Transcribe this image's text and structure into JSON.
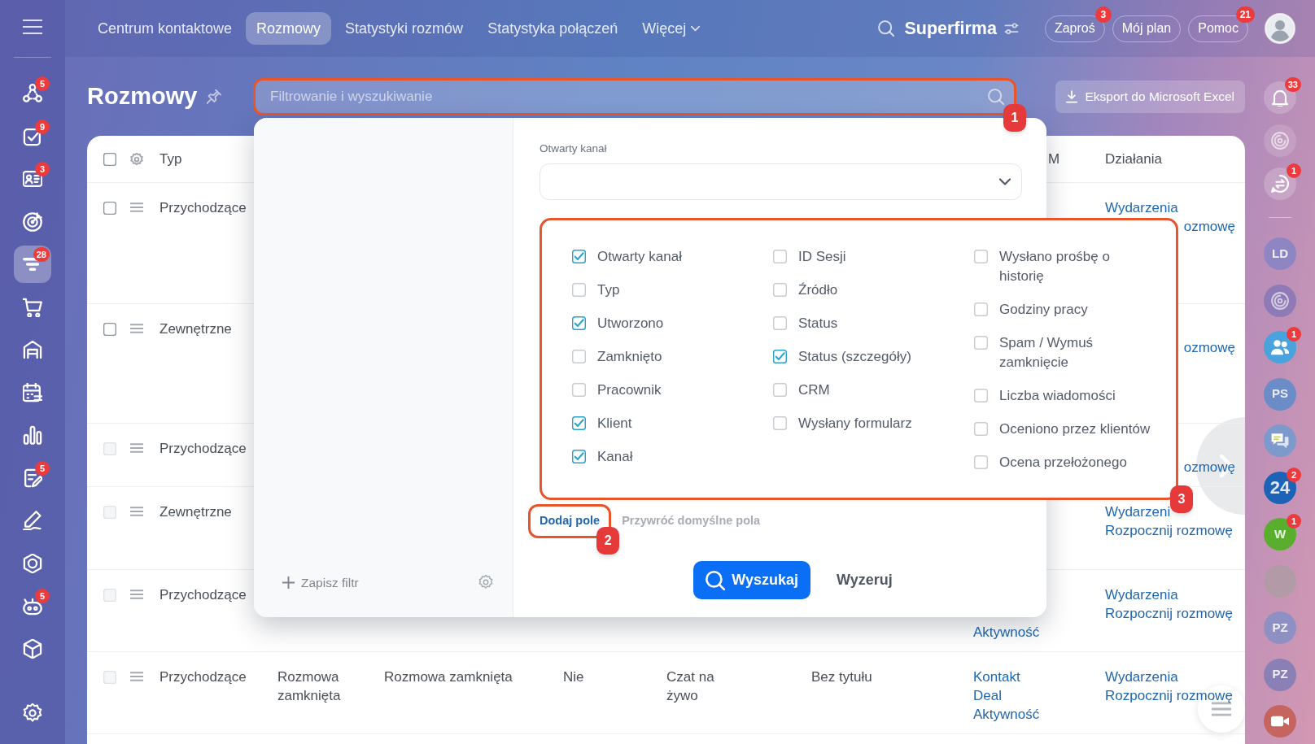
{
  "left_sidebar": {
    "items": [
      {
        "badge": "5",
        "selected": false
      },
      {
        "badge": "9",
        "selected": false
      },
      {
        "badge": "3",
        "selected": false
      },
      {
        "selected": false
      },
      {
        "badge": "28",
        "selected": true
      },
      {
        "selected": false
      },
      {
        "selected": false
      },
      {
        "selected": false
      },
      {
        "selected": false
      },
      {
        "badge": "5",
        "selected": false
      },
      {
        "selected": false
      },
      {
        "selected": false
      },
      {
        "badge": "5",
        "selected": false
      },
      {
        "selected": false
      }
    ]
  },
  "nav_tabs": [
    {
      "label": "Centrum kontaktowe",
      "selected": false,
      "kind": "link"
    },
    {
      "label": "Rozmowy",
      "selected": true,
      "kind": "link"
    },
    {
      "label": "Statystyki rozmów",
      "selected": false,
      "kind": "link"
    },
    {
      "label": "Statystyka połączeń",
      "selected": false,
      "kind": "link"
    },
    {
      "label": "Więcej",
      "selected": false,
      "kind": "menu"
    }
  ],
  "company": {
    "name": "Superfirma"
  },
  "header_buttons": [
    {
      "label": "Zaproś",
      "badge": "3"
    },
    {
      "label": "Mój plan"
    },
    {
      "label": "Pomoc",
      "badge": "21"
    }
  ],
  "page": {
    "title": "Rozmowy"
  },
  "search_field": {
    "placeholder": "Filtrowanie i wyszukiwanie",
    "highlighted": true,
    "annotation": "1"
  },
  "export_button": {
    "label": "Eksport do Microsoft Excel"
  },
  "right_sidebar": {
    "items": [
      {
        "kind": "button",
        "badge": "33"
      },
      {
        "kind": "button"
      },
      {
        "kind": "button",
        "badge": "1"
      },
      {
        "kind": "initials",
        "text": "LD",
        "color": "#8e86c2"
      },
      {
        "kind": "button"
      },
      {
        "kind": "button",
        "badge": "1"
      },
      {
        "kind": "initials",
        "text": "PS",
        "color": "#6b8cc6"
      },
      {
        "kind": "button"
      },
      {
        "kind": "initials",
        "text": "24",
        "color": "#1c63b7",
        "badge": "2"
      },
      {
        "kind": "initials",
        "text": "W",
        "color": "#5aae2e",
        "badge": "1"
      },
      {
        "kind": "photo"
      },
      {
        "kind": "initials",
        "text": "PZ",
        "color": "#8e90c3"
      },
      {
        "kind": "initials",
        "text": "PZ",
        "color": "#8a80b6"
      },
      {
        "kind": "button"
      }
    ]
  },
  "table": {
    "header": {
      "checkbox": {
        "checked": false
      },
      "column_1": "Typ",
      "column_7": "M",
      "column_8": "Działania"
    },
    "rows": [
      {
        "checkbox": {
          "checked": false,
          "disabled": false
        },
        "column_1": "Przychodzące",
        "column_8": {
          "events": {
            "text": "Wydarzenia",
            "cut_start": false
          },
          "start_chat": {
            "text": "ozmowę",
            "cut_start": true
          }
        }
      },
      {
        "checkbox": {
          "checked": false,
          "disabled": false
        },
        "column_1": "Zewnętrzne",
        "column_8": {
          "start_chat": {
            "text": "ozmowę",
            "cut_start": true
          }
        }
      },
      {
        "checkbox": {
          "checked": false,
          "disabled": true
        },
        "column_1": "Przychodzące",
        "column_8": {
          "start_chat": {
            "text": "ozmowę",
            "cut_start": true
          }
        }
      },
      {
        "checkbox": {
          "checked": false,
          "disabled": true
        },
        "column_1": "Zewnętrzne",
        "column_8": {
          "events": {
            "text": "Wydarzeni",
            "cut_start": false
          },
          "start_chat": {
            "text": "Rozpocznij rozmowę",
            "cut_start": false
          }
        }
      },
      {
        "checkbox": {
          "checked": false,
          "disabled": true
        },
        "column_1": "Przychodzące",
        "column_7": {
          "activity": "Aktywność"
        },
        "column_8": {
          "events": {
            "text": "Wydarzenia",
            "cut_start": false
          },
          "start_chat": {
            "text": "Rozpocznij rozmowę",
            "cut_start": false
          }
        }
      },
      {
        "checkbox": {
          "checked": false,
          "disabled": true
        },
        "column_1": "Przychodzące",
        "column_2": "Rozmowa zamknięta",
        "column_3": "Rozmowa zamknięta",
        "column_4": "Nie",
        "column_5": "Czat na żywo",
        "column_6": "Bez tytułu",
        "column_7": {
          "contact": "Kontakt",
          "deal": "Deal",
          "activity": "Aktywność"
        },
        "column_8": {
          "events": {
            "text": "Wydarzenia",
            "cut_start": false
          },
          "start_chat": {
            "text": "Rozpocznij rozmowę",
            "cut_start": false
          }
        }
      }
    ]
  },
  "filter_popup": {
    "save_filter_button": "Zapisz filtr",
    "open_channel_select": {
      "label": "Otwarty kanał"
    },
    "fields_panel": {
      "highlighted": true,
      "annotation": "3",
      "columns": [
        {
          "fields": [
            {
              "label": "Otwarty kanał",
              "checked": true
            },
            {
              "label": "Typ",
              "checked": false
            },
            {
              "label": "Utworzono",
              "checked": true
            },
            {
              "label": "Zamknięto",
              "checked": false
            },
            {
              "label": "Pracownik",
              "checked": false
            },
            {
              "label": "Klient",
              "checked": true
            },
            {
              "label": "Kanał",
              "checked": true
            }
          ]
        },
        {
          "fields": [
            {
              "label": "ID Sesji",
              "checked": false
            },
            {
              "label": "Źródło",
              "checked": false
            },
            {
              "label": "Status",
              "checked": false
            },
            {
              "label": "Status (szczegóły)",
              "checked": true
            },
            {
              "label": "CRM",
              "checked": false
            },
            {
              "label": "Wysłany formularz",
              "checked": false
            }
          ]
        },
        {
          "fields": [
            {
              "label": "Wysłano prośbę o historię",
              "checked": false
            },
            {
              "label": "Godziny pracy",
              "checked": false
            },
            {
              "label": "Spam / Wymuś zamknięcie",
              "checked": false
            },
            {
              "label": "Liczba wiadomości",
              "checked": false
            },
            {
              "label": "Oceniono przez klientów",
              "checked": false
            },
            {
              "label": "Ocena przełożonego",
              "checked": false
            }
          ]
        }
      ]
    },
    "add_field_link": {
      "text": "Dodaj pole",
      "highlighted": true,
      "annotation": "2"
    },
    "restore_defaults_link": "Przywróć domyślne pola",
    "search_button": "Wyszukaj",
    "reset_button": "Wyzeruj"
  }
}
